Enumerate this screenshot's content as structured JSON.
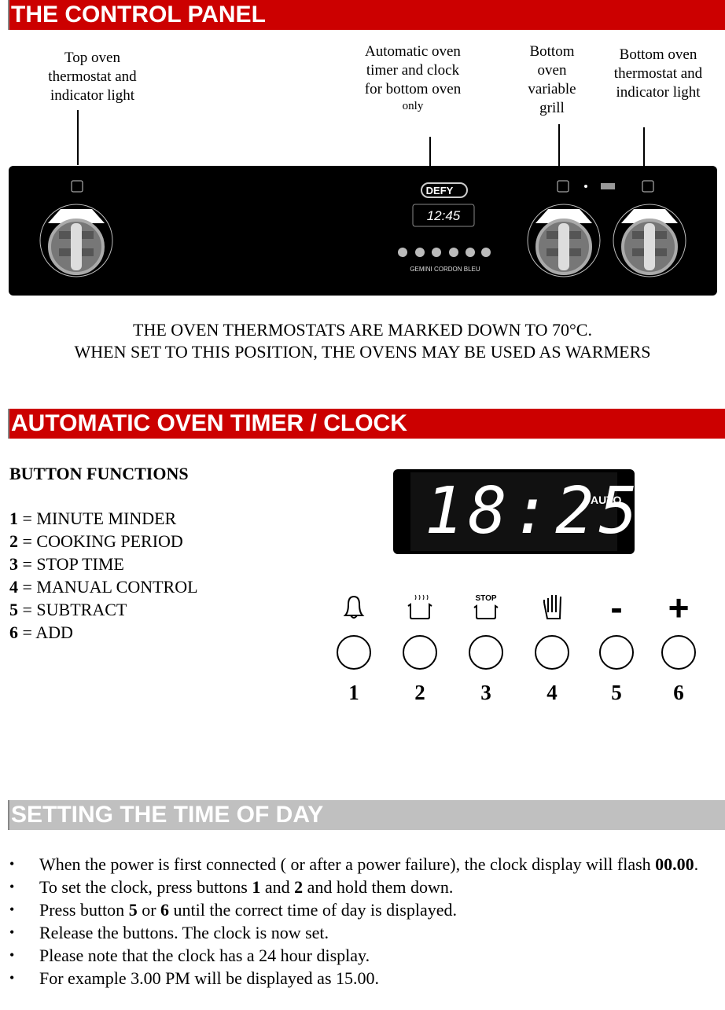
{
  "sections": {
    "control_panel": "THE CONTROL PANEL",
    "timer": "AUTOMATIC OVEN TIMER / CLOCK",
    "set_time": "SETTING THE TIME OF DAY"
  },
  "colors": {
    "header_red": "#cc0000",
    "header_grey": "#c0c0c0"
  },
  "callouts": {
    "top_oven": "Top oven thermostat and indicator light",
    "timer": "Automatic oven timer and clock for bottom oven",
    "timer_small": "only",
    "grill": "Bottom oven variable grill",
    "bottom_oven": "Bottom oven thermostat and indicator light"
  },
  "panel": {
    "brand": "DEFY",
    "clock": "12:45",
    "model": "GEMINI CORDON BLEU",
    "button_marks": [
      "bell",
      "pot",
      "stop-pot",
      "hand",
      "-",
      "+"
    ]
  },
  "note": [
    "THE OVEN THERMOSTATS ARE MARKED DOWN TO 70°C.",
    "WHEN SET TO THIS POSITION, THE OVENS MAY BE USED AS WARMERS"
  ],
  "button_functions": {
    "title": "BUTTON FUNCTIONS",
    "items": [
      {
        "n": "1",
        "label": " = MINUTE MINDER"
      },
      {
        "n": "2",
        "label": " = COOKING PERIOD"
      },
      {
        "n": "3",
        "label": " = STOP TIME"
      },
      {
        "n": "4",
        "label": " = MANUAL CONTROL"
      },
      {
        "n": "5",
        "label": " = SUBTRACT"
      },
      {
        "n": "6",
        "label": " = ADD"
      }
    ]
  },
  "display": {
    "time": "18:25",
    "auto": "AUTO"
  },
  "timer_buttons": [
    {
      "icon": "bell-icon",
      "num": "1"
    },
    {
      "icon": "cooking-pot-icon",
      "num": "2"
    },
    {
      "icon": "stop-pot-icon",
      "num": "3",
      "text": "STOP"
    },
    {
      "icon": "hand-icon",
      "num": "4"
    },
    {
      "icon": "minus-icon",
      "num": "5",
      "text": "-"
    },
    {
      "icon": "plus-icon",
      "num": "6",
      "text": "+"
    }
  ],
  "instructions": [
    {
      "pre": "When the power is first connected ( or after a power failure), the clock display will flash ",
      "bold": "00.00",
      "post": "."
    },
    {
      "pre": "To set the clock, press buttons ",
      "bold": "1",
      "mid": " and ",
      "bold2": "2",
      "post": " and hold them down."
    },
    {
      "pre": "Press button ",
      "bold": "5",
      "mid": " or ",
      "bold2": "6",
      "post": " until the correct time of day is displayed."
    },
    {
      "pre": "Release the buttons. The clock is now set."
    },
    {
      "pre": "Please note that the clock has a 24 hour display."
    },
    {
      "pre": "For example 3.00 PM will be displayed as 15.00."
    }
  ]
}
